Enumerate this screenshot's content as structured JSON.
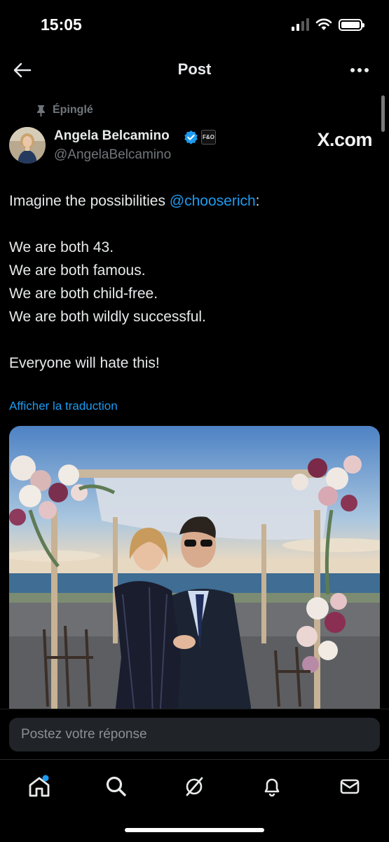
{
  "status_bar": {
    "time": "15:05"
  },
  "header": {
    "title": "Post"
  },
  "pinned_label": "Épinglé",
  "author": {
    "name": "Angela Belcamino",
    "handle": "@AngelaBelcamino",
    "affiliate_badge": "F&O"
  },
  "watermark": "X.com",
  "tweet": {
    "line1_text": "Imagine the possibilities ",
    "line1_mention": "@chooserich",
    "line1_suffix": ":",
    "line2": "We are both 43.",
    "line3": "We are both famous.",
    "line4": "We are both child-free.",
    "line5": "We are both wildly successful.",
    "line6": "Everyone will hate this!"
  },
  "translate_link": "Afficher la traduction",
  "reply": {
    "placeholder": "Postez votre réponse"
  },
  "tabs": [
    "home-icon",
    "search-icon",
    "grok-icon",
    "notifications-icon",
    "messages-icon"
  ],
  "colors": {
    "accent": "#1d9bf0",
    "background": "#000000",
    "muted": "#71767b",
    "notification_dot": "#1d9bf0"
  }
}
